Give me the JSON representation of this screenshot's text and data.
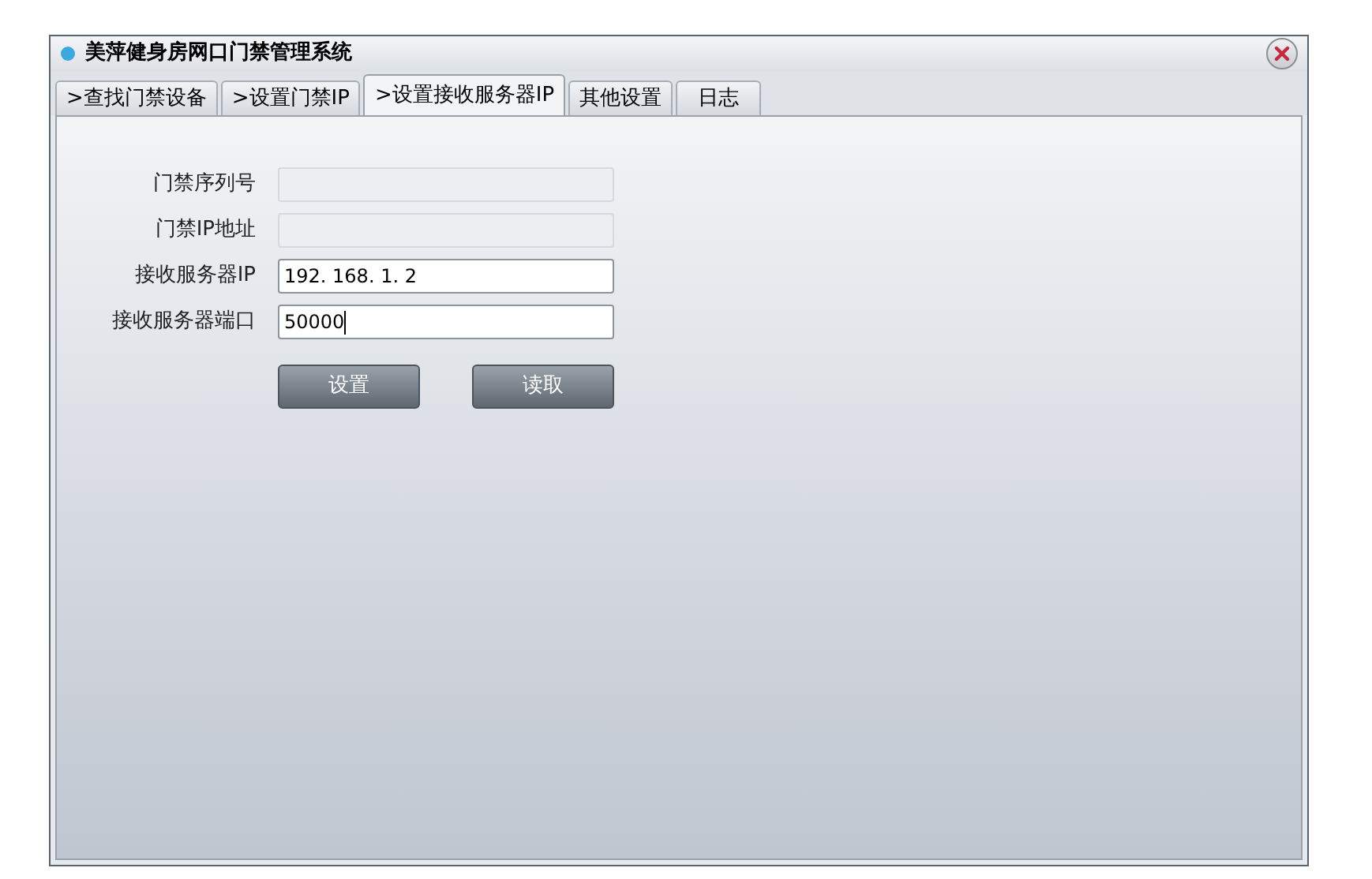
{
  "window": {
    "title": "美萍健身房网口门禁管理系统"
  },
  "tabs": [
    {
      "label": ">查找门禁设备",
      "selected": false
    },
    {
      "label": ">设置门禁IP",
      "selected": false
    },
    {
      "label": ">设置接收服务器IP",
      "selected": true
    },
    {
      "label": "其他设置",
      "selected": false
    },
    {
      "label": "日志",
      "selected": false
    }
  ],
  "fields": [
    {
      "label": "门禁序列号",
      "disabled": true,
      "focused": false
    },
    {
      "label": "门禁IP地址",
      "disabled": true,
      "focused": false
    },
    {
      "label": "接收服务器IP",
      "value": "192. 168. 1. 2",
      "disabled": false,
      "focused": false
    },
    {
      "label": "接收服务器端口",
      "value": "50000",
      "disabled": false,
      "focused": true
    }
  ],
  "buttons": [
    "设置",
    "读取"
  ]
}
